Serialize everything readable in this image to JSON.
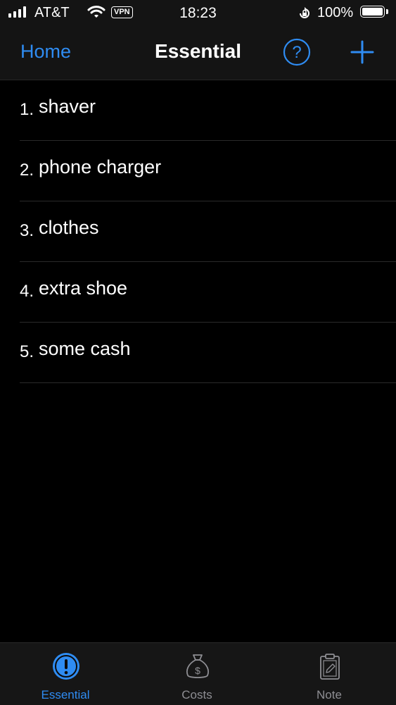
{
  "status_bar": {
    "carrier": "AT&T",
    "vpn": "VPN",
    "time": "18:23",
    "battery_percent": "100%",
    "signal_bars": 4,
    "battery_level": 1.0
  },
  "nav": {
    "back_label": "Home",
    "title": "Essential",
    "help_icon": "question-circle-icon",
    "add_icon": "plus-icon",
    "accent_color": "#2f8cf2"
  },
  "list": {
    "items": [
      {
        "number": "1.",
        "text": "shaver"
      },
      {
        "number": "2.",
        "text": "phone charger"
      },
      {
        "number": "3.",
        "text": "clothes"
      },
      {
        "number": "4.",
        "text": "extra shoe"
      },
      {
        "number": "5.",
        "text": "some cash"
      }
    ]
  },
  "tabs": [
    {
      "label": "Essential",
      "icon": "exclamation-circle-icon",
      "active": true
    },
    {
      "label": "Costs",
      "icon": "money-bag-icon",
      "active": false
    },
    {
      "label": "Note",
      "icon": "clipboard-pencil-icon",
      "active": false
    }
  ]
}
